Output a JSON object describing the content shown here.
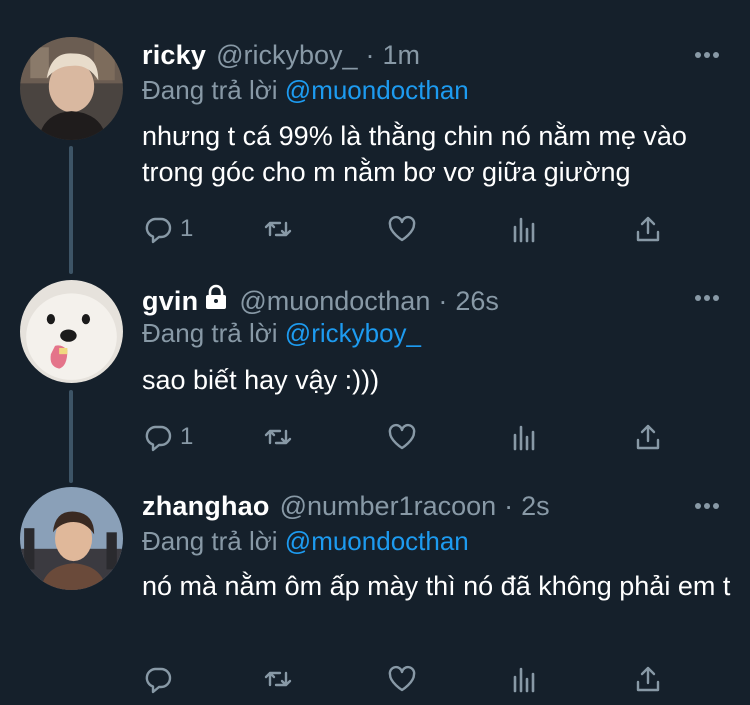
{
  "colors": {
    "background": "#15202b",
    "secondary_text": "#8899a6",
    "link": "#1d9bf0",
    "thread_line": "#3d5466"
  },
  "tweets": [
    {
      "name": "ricky",
      "handle": "@rickyboy_",
      "separator": "·",
      "time": "1m",
      "reply_prefix": "Đang trả lời",
      "reply_to": "@muondocthan",
      "text": "nhưng t cá 99% là thằng chin nó nằm mẹ vào trong góc cho m nằm bơ vơ giữa giường",
      "reply_count": "1",
      "protected": false
    },
    {
      "name": "gvin",
      "handle": "@muondocthan",
      "separator": "·",
      "time": "26s",
      "reply_prefix": "Đang trả lời",
      "reply_to": "@rickyboy_",
      "text": "sao biết hay vậy :)))",
      "reply_count": "1",
      "protected": true
    },
    {
      "name": "zhanghao",
      "handle": "@number1racoon",
      "separator": "·",
      "time": "2s",
      "reply_prefix": "Đang trả lời",
      "reply_to": "@muondocthan",
      "text": "nó mà nằm ôm ấp mày thì nó đã không phải em t",
      "reply_count": "",
      "protected": false
    }
  ],
  "icons": [
    "reply-icon",
    "retweet-icon",
    "like-icon",
    "analytics-icon",
    "share-icon",
    "more-icon",
    "lock-icon"
  ]
}
